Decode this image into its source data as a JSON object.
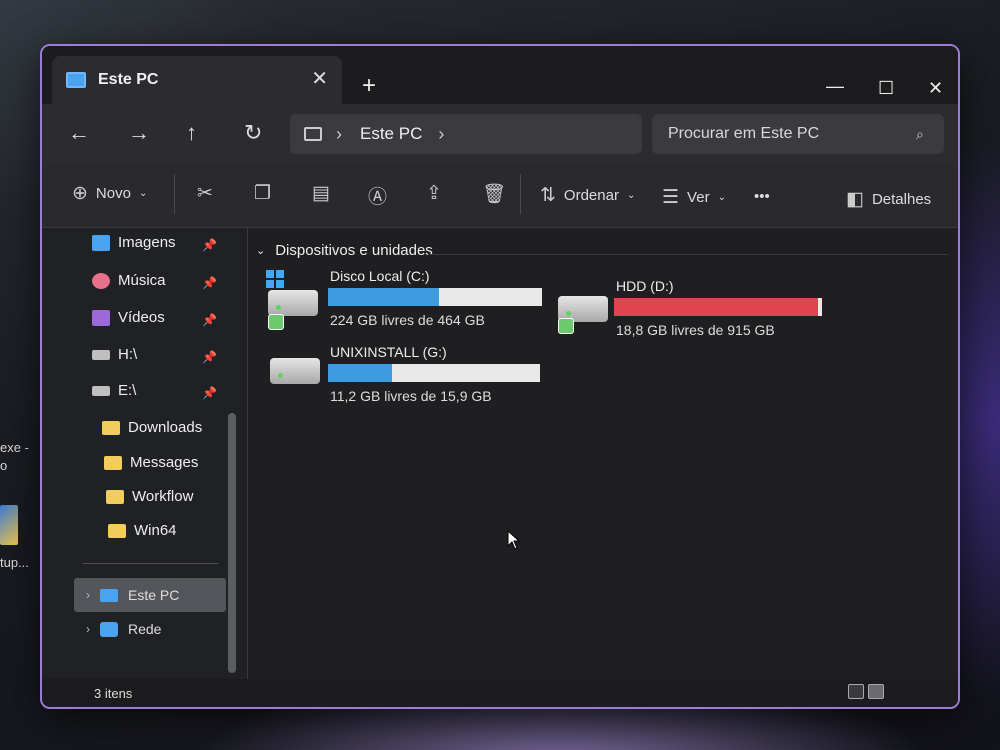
{
  "desktop": {
    "frag_1": "exe -",
    "frag_2": "o",
    "frag_3": "tup..."
  },
  "window": {
    "tab_title": "Este PC",
    "tab_close": "✕",
    "new_tab": "+",
    "minimize": "—",
    "maximize": "☐",
    "close": "✕"
  },
  "nav": {
    "back": "←",
    "forward": "→",
    "up": "↑",
    "refresh": "↻",
    "breadcrumb": [
      "Este PC"
    ],
    "search_placeholder": "Procurar em Este PC"
  },
  "commands": {
    "new_label": "Novo",
    "sort_label": "Ordenar",
    "view_label": "Ver",
    "more": "•••",
    "details_label": "Detalhes"
  },
  "sidebar": {
    "quick": [
      {
        "label": "Imagens",
        "icon": "images-icon",
        "color": "#4aa3f0"
      },
      {
        "label": "Música",
        "icon": "music-icon",
        "color": "#e8708a"
      },
      {
        "label": "Vídeos",
        "icon": "videos-icon",
        "color": "#9c6ad6"
      },
      {
        "label": "H:\\",
        "icon": "drive-icon"
      },
      {
        "label": "E:\\",
        "icon": "drive-icon"
      },
      {
        "label": "Downloads",
        "icon": "folder-icon"
      },
      {
        "label": "Messages",
        "icon": "folder-icon"
      },
      {
        "label": "Workflow",
        "icon": "folder-icon"
      },
      {
        "label": "Win64",
        "icon": "folder-icon"
      }
    ],
    "este_pc": "Este PC",
    "rede": "Rede"
  },
  "content": {
    "group_title": "Dispositivos e unidades",
    "drives": [
      {
        "name": "Disco Local (C:)",
        "free": "224 GB livres de 464 GB",
        "used_fraction": 0.52,
        "color": "#3f9be0"
      },
      {
        "name": "HDD (D:)",
        "free": "18,8 GB livres de 915 GB",
        "used_fraction": 0.98,
        "color": "#e0444f"
      },
      {
        "name": "UNIXINSTALL (G:)",
        "free": "11,2 GB livres de 15,9 GB",
        "used_fraction": 0.3,
        "color": "#3f9be0"
      }
    ]
  },
  "status": {
    "count": "3 itens"
  }
}
